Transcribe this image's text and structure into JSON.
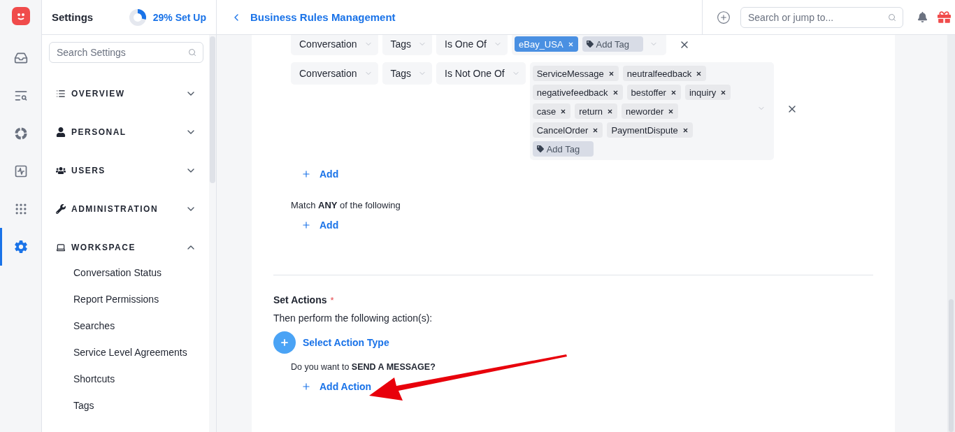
{
  "nav_rail": [
    {
      "selected": false
    },
    {
      "selected": false
    },
    {
      "selected": false
    },
    {
      "selected": false
    },
    {
      "selected": false
    },
    {
      "selected": true
    }
  ],
  "settings_panel": {
    "title": "Settings",
    "setup": {
      "label": "29% Set Up",
      "level": 0.29
    },
    "search": {
      "placeholder": "Search Settings"
    },
    "sections": [
      {
        "label": "OVERVIEW",
        "expanded": false
      },
      {
        "label": "PERSONAL",
        "expanded": false
      },
      {
        "label": "USERS",
        "expanded": false
      },
      {
        "label": "ADMINISTRATION",
        "expanded": false
      },
      {
        "label": "WORKSPACE",
        "expanded": true,
        "items": [
          "Conversation Status",
          "Report Permissions",
          "Searches",
          "Service Level Agreements",
          "Shortcuts",
          "Tags"
        ]
      }
    ]
  },
  "header": {
    "title": "Business Rules Management",
    "search": {
      "placeholder": "Search or jump to..."
    }
  },
  "conditions": [
    {
      "field": "Conversation",
      "attribute": "Tags",
      "operator": "Is One Of",
      "tags": [
        {
          "label": "eBay_USA",
          "highlighted": true
        }
      ],
      "add_tag": "Add Tag"
    },
    {
      "field": "Conversation",
      "attribute": "Tags",
      "operator": "Is Not One Of",
      "tags": [
        {
          "label": "ServiceMessage",
          "highlighted": false
        },
        {
          "label": "neutralfeedback",
          "highlighted": false
        },
        {
          "label": "negativefeedback",
          "highlighted": false
        },
        {
          "label": "bestoffer",
          "highlighted": false
        },
        {
          "label": "inquiry",
          "highlighted": false
        },
        {
          "label": "case",
          "highlighted": false
        },
        {
          "label": "return",
          "highlighted": false
        },
        {
          "label": "neworder",
          "highlighted": false
        },
        {
          "label": "CancelOrder",
          "highlighted": false
        },
        {
          "label": "PaymentDispute",
          "highlighted": false
        }
      ],
      "add_tag": "Add Tag"
    }
  ],
  "add_condition": "Add",
  "match_any": {
    "text": "Match **ANY** of the following",
    "add": "Add"
  },
  "actions": {
    "title": "Set Actions",
    "required": "*",
    "subtitle": "Then perform the following action(s):",
    "select_type": "Select Action Type",
    "question": "Do you want to **SEND A MESSAGE?**",
    "add_action": "Add Action"
  }
}
